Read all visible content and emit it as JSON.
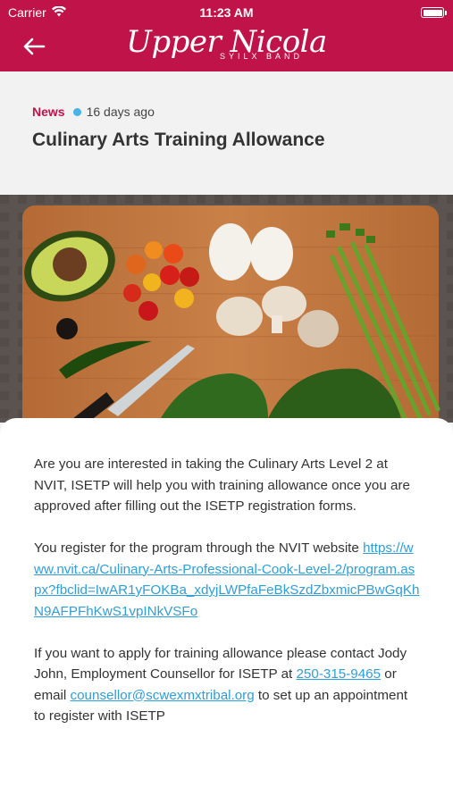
{
  "status_bar": {
    "carrier": "Carrier",
    "time": "11:23 AM"
  },
  "header": {
    "logo_main": "Upper Nicola",
    "logo_sub": "SYILX BAND",
    "accent_color": "#c0134a"
  },
  "article": {
    "category": "News",
    "age": "16 days ago",
    "title": "Culinary Arts Training Allowance",
    "hero_image_icon": "cutting-board-vegetables-photo",
    "paragraph1": "Are you are interested in taking the Culinary Arts Level 2 at NVIT, ISETP will help you with training allowance once you are approved after filling out the ISETP registration forms.",
    "paragraph2_text": "You register for the program through the NVIT website ",
    "paragraph2_link": "https://www.nvit.ca/Culinary-Arts-Professional-Cook-Level-2/program.aspx?fbclid=IwAR1yFOKBa_xdyjLWPfaFeBkSzdZbxmicPBwGqKhN9AFPFhKwS1vpINkVSFo",
    "paragraph3_text1": "If you want to apply for training allowance please contact Jody John, Employment Counsellor for ISETP at ",
    "paragraph3_phone": "250-315-9465",
    "paragraph3_text2": " or email ",
    "paragraph3_email": "counsellor@scwexmxtribal.org",
    "paragraph3_text3": " to set up an appointment to register with ISETP"
  },
  "colors": {
    "link": "#2f9ed9",
    "dot": "#4ab3e8"
  }
}
